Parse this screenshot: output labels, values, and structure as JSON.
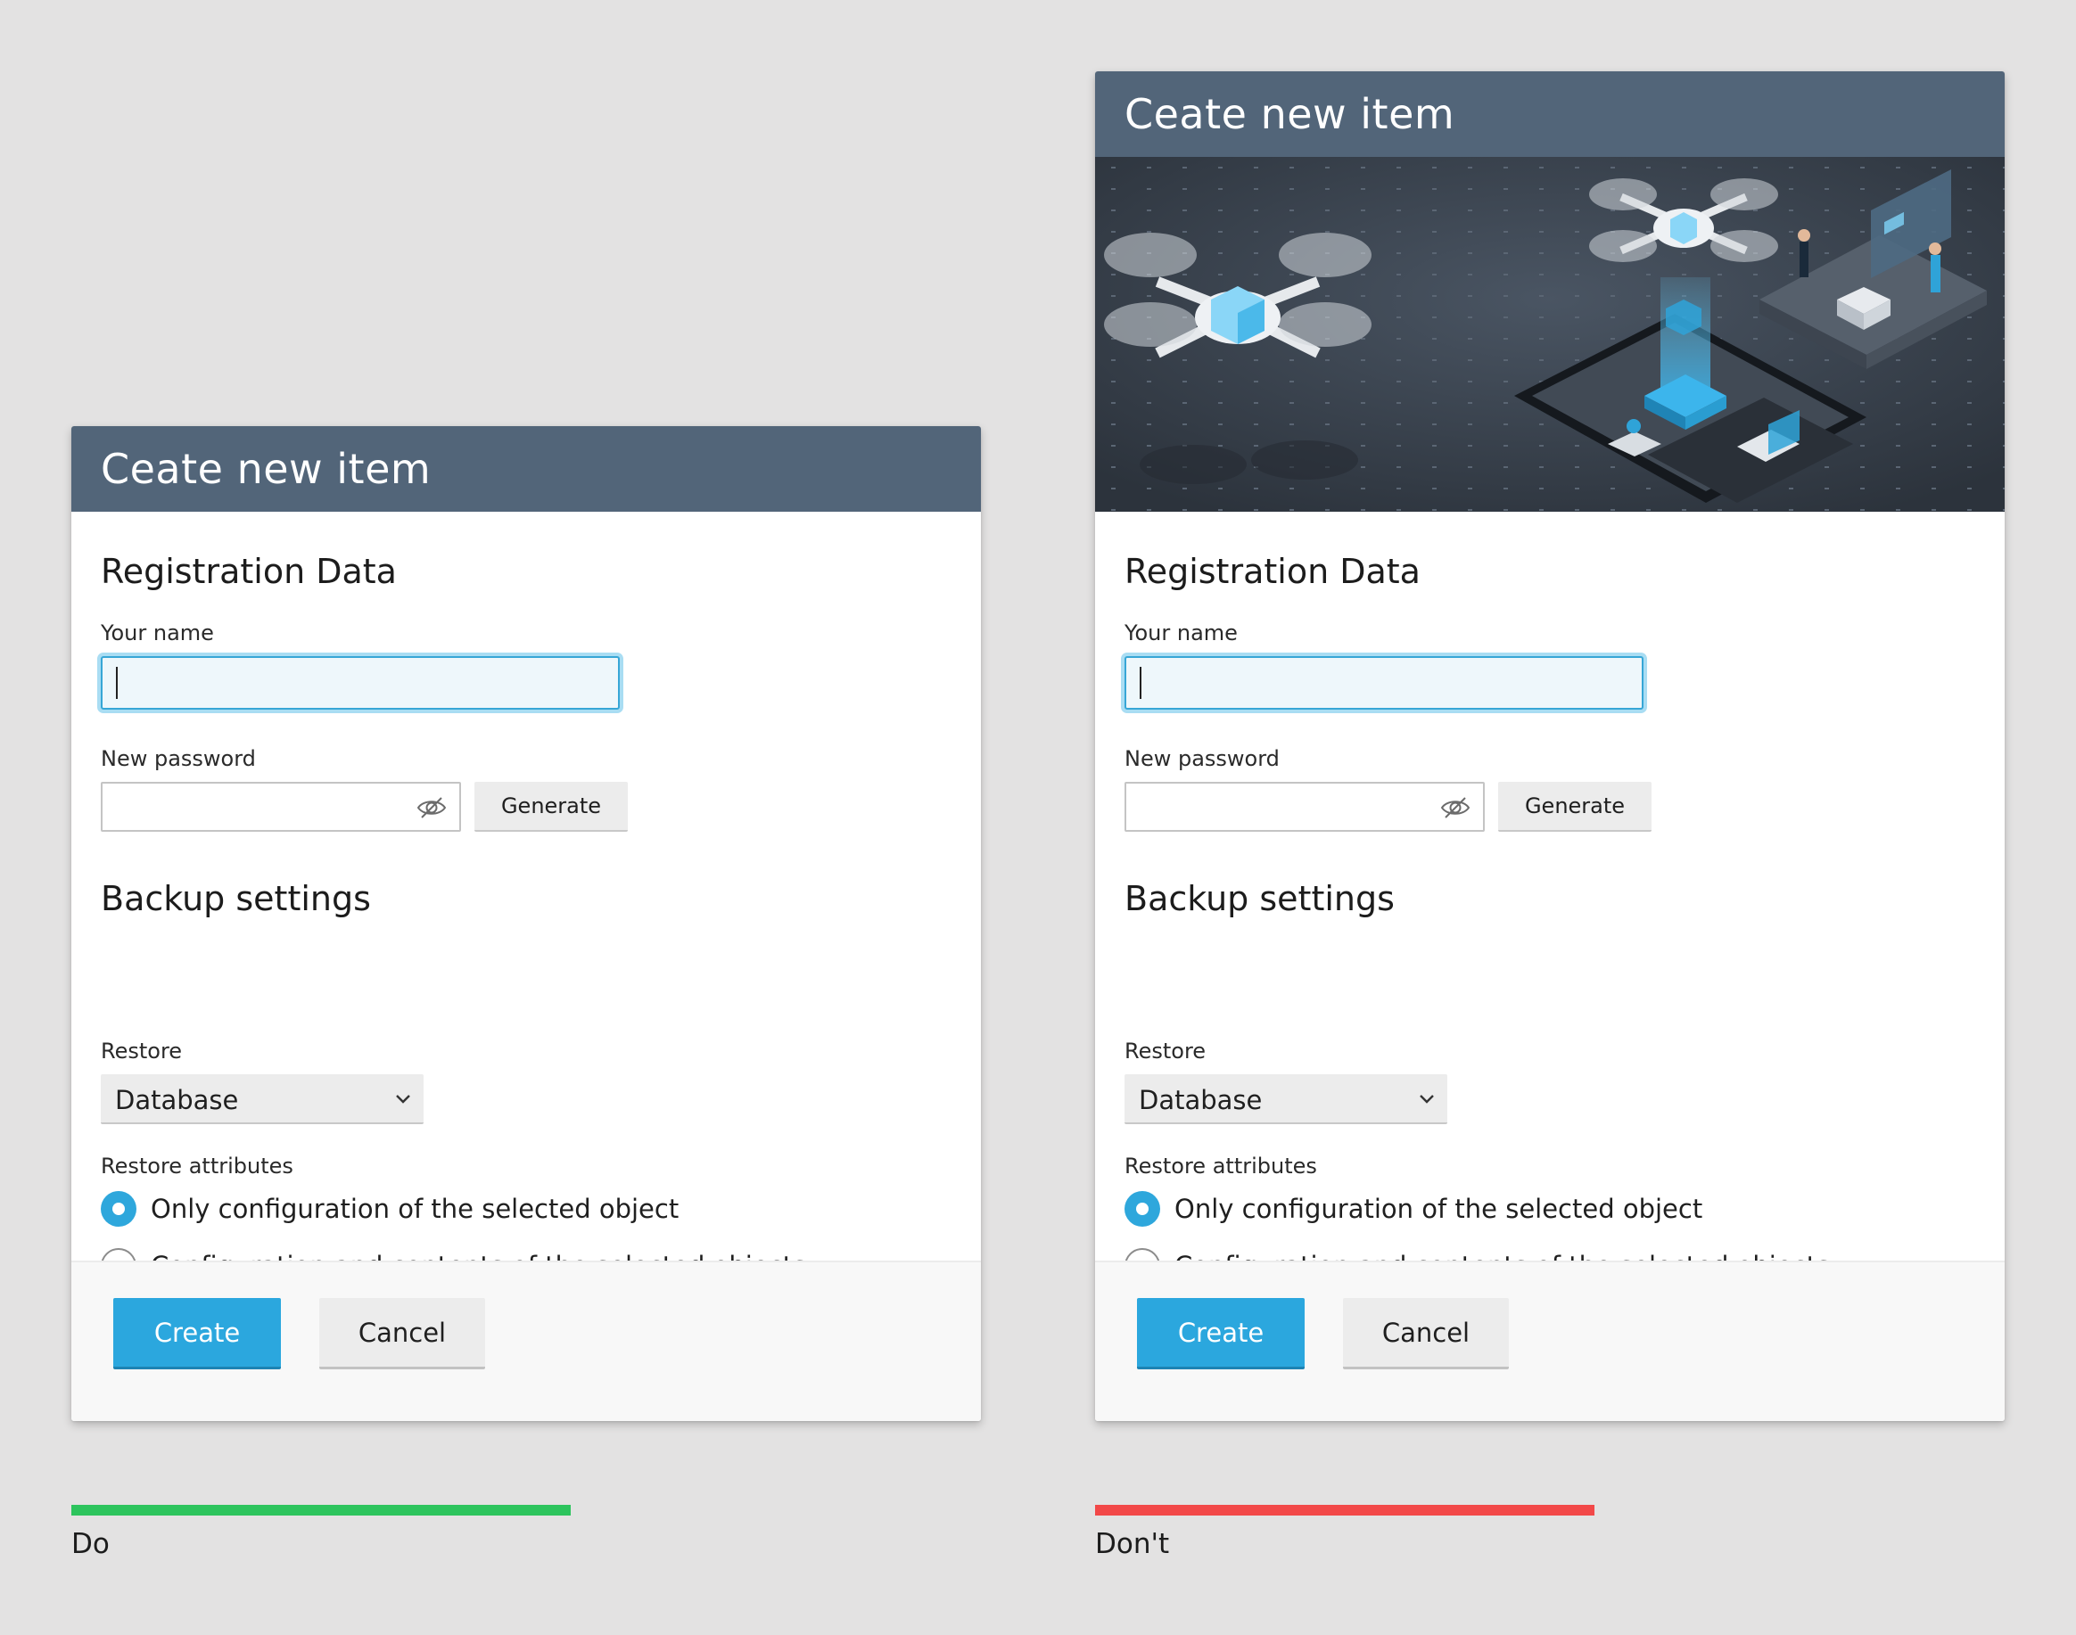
{
  "colors": {
    "page_background": "#e3e2e2",
    "header": "#526579",
    "accent": "#2ba7de",
    "do": "#2dc45d",
    "dont": "#f24848"
  },
  "panels": [
    {
      "dialog_title": "Ceate new item",
      "has_hero_illustration": false,
      "registration_title": "Registration Data",
      "name_label": "Your name",
      "name_value": "",
      "password_label": "New password",
      "password_icon": "eye-slash-icon",
      "generate_label": "Generate",
      "backup_title": "Backup settings",
      "restore_label": "Restore",
      "restore_value": "Database",
      "attributes_label": "Restore attributes",
      "radio_options": [
        {
          "label": "Only configuration of the selected object",
          "checked": true
        },
        {
          "label": "Configuration and contents of the selected objects",
          "checked": false
        }
      ],
      "create_label": "Create",
      "cancel_label": "Cancel",
      "verdict": "Do",
      "verdict_color": "#2dc45d"
    },
    {
      "dialog_title": "Ceate new item",
      "has_hero_illustration": true,
      "hero_illustration": "drones-isometric-illustration",
      "registration_title": "Registration Data",
      "name_label": "Your name",
      "name_value": "",
      "password_label": "New password",
      "password_icon": "eye-slash-icon",
      "generate_label": "Generate",
      "backup_title": "Backup settings",
      "restore_label": "Restore",
      "restore_value": "Database",
      "attributes_label": "Restore attributes",
      "radio_options": [
        {
          "label": "Only configuration of the selected object",
          "checked": true
        },
        {
          "label": "Configuration and contents of the selected objects",
          "checked": false
        }
      ],
      "create_label": "Create",
      "cancel_label": "Cancel",
      "verdict": "Don't",
      "verdict_color": "#f24848"
    }
  ]
}
